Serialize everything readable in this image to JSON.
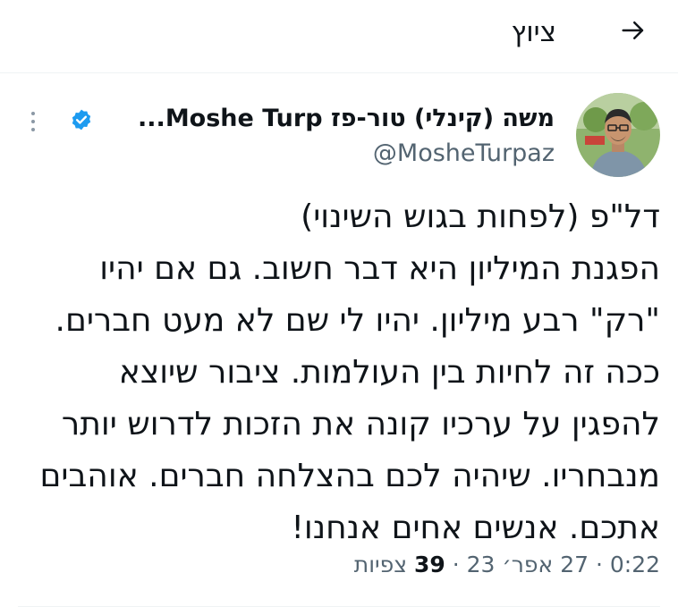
{
  "header": {
    "title": "ציוץ",
    "back_icon": "arrow-right-icon"
  },
  "tweet": {
    "author_name": "משה (קינלי) טור-פז Moshe Turp...",
    "handle": "@MosheTurpaz",
    "verified_icon": "verified-badge-icon",
    "more_icon": "more-vertical-icon",
    "text_lines": [
      "דל\"פ (לפחות בגוש השינוי)",
      "הפגנת המיליון היא דבר חשוב. גם אם יהיו",
      "\"רק\" רבע מיליון. יהיו לי שם לא מעט חברים.",
      "ככה זה לחיות בין העולמות. ציבור שיוצא",
      "להפגין על ערכיו קונה את הזכות לדרוש יותר",
      "מנבחריו. שיהיה לכם בהצלחה חברים. אוהבים",
      "אתכם. אנשים אחים אנחנו!"
    ],
    "time": "0:22",
    "date": "27 אפר׳ 23",
    "views_count": "39",
    "views_label": "צפיות"
  },
  "colors": {
    "accent": "#1d9bf0",
    "secondary_text": "#536471",
    "divider": "#eff3f4"
  }
}
